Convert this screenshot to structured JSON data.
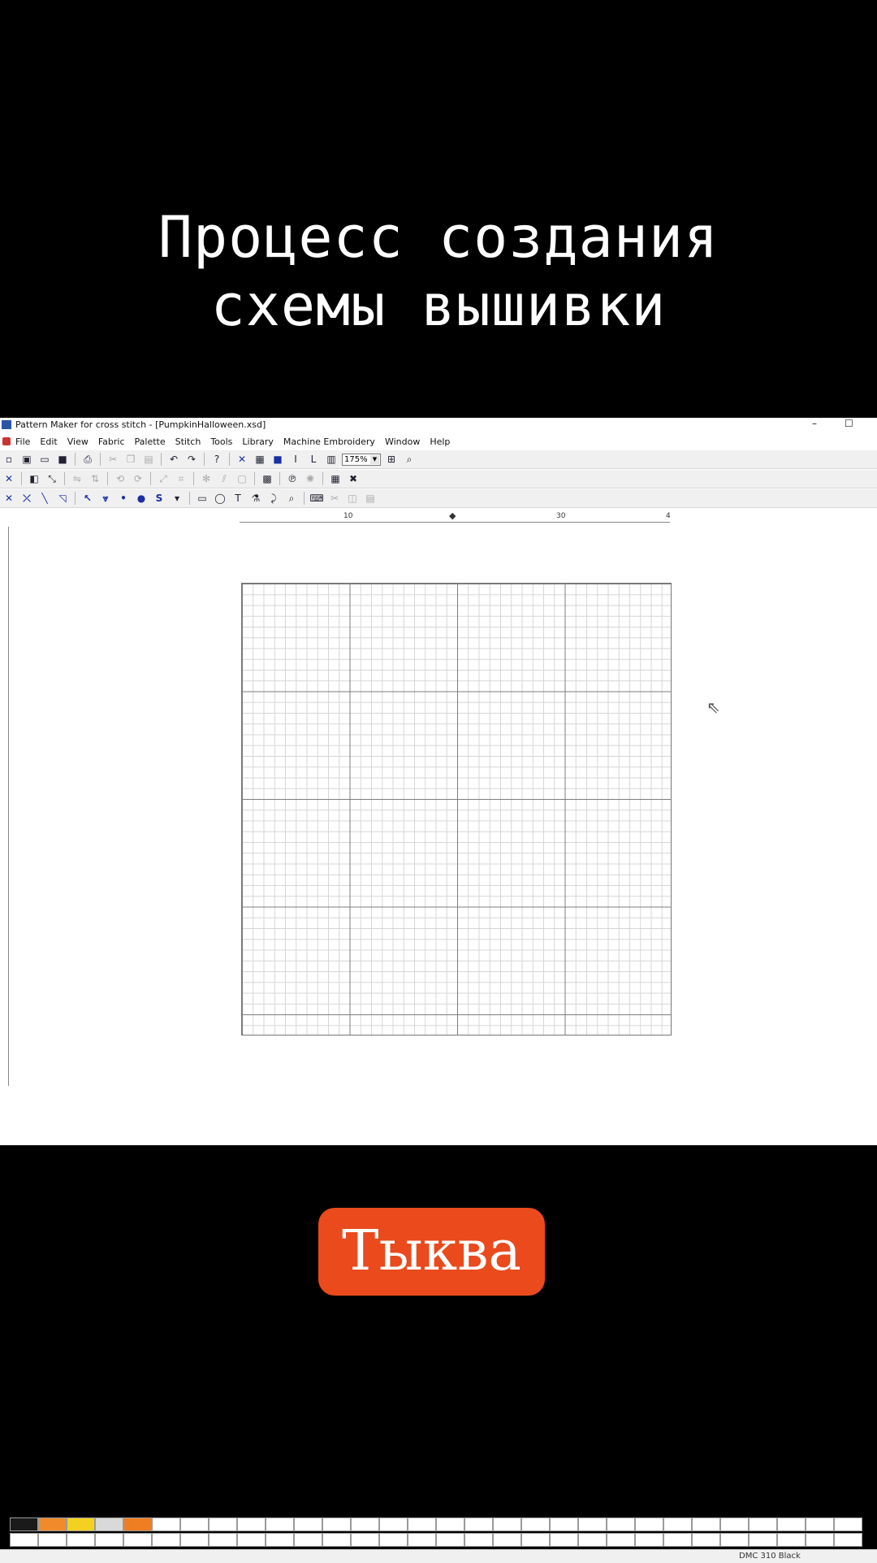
{
  "headline": {
    "line1": "Процесс создания",
    "line2": "схемы вышивки"
  },
  "window": {
    "title": "Pattern Maker for cross stitch - [PumpkinHalloween.xsd]",
    "minimize": "–",
    "maximize": "☐"
  },
  "menu": [
    "File",
    "Edit",
    "View",
    "Fabric",
    "Palette",
    "Stitch",
    "Tools",
    "Library",
    "Machine Embroidery",
    "Window",
    "Help"
  ],
  "zoom": {
    "value": "175%"
  },
  "ruler": {
    "labels": [
      "10",
      "30",
      "4"
    ]
  },
  "palette_colors": [
    "#1a1a1a",
    "#f08a2a",
    "#f2d21e",
    "#d9d9d9",
    "#ef7d22"
  ],
  "status": {
    "thread": "DMC 310 Black"
  },
  "caption": {
    "label": "Тыква"
  },
  "colors": {
    "caption_bg": "#ea4a1c",
    "background": "#000000"
  }
}
